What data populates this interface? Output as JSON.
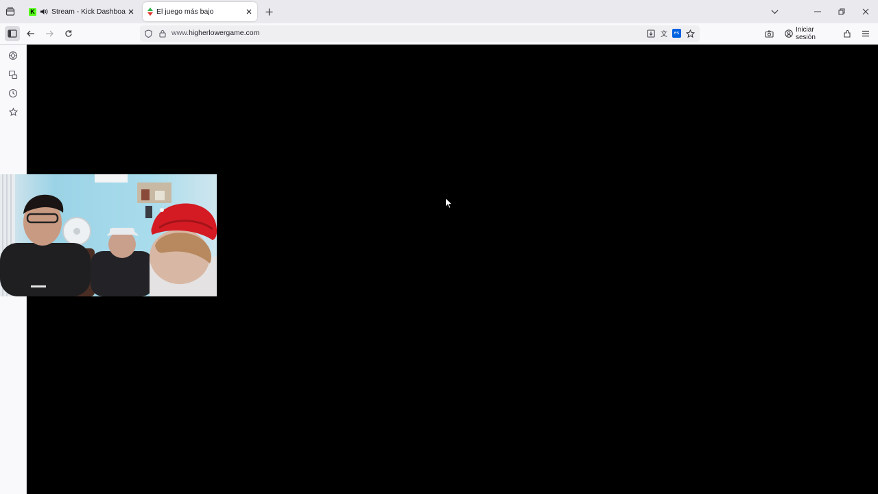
{
  "tabs": [
    {
      "title": "Stream - Kick Dashboard",
      "favicon": "kick-logo",
      "favicon_letter": "K",
      "audio": "speaker-icon"
    },
    {
      "title": "El juego más bajo",
      "favicon": "higher-lower-arrows",
      "active": true
    }
  ],
  "address_bar": {
    "url_prefix": "www.",
    "url_host": "higherlowergame.com",
    "translate_badge": "es"
  },
  "toolbar": {
    "signin_label": "Iniciar sesión"
  },
  "colors": {
    "kick_green": "#53fc18",
    "accent_blue": "#0061e0",
    "page_background": "#000000"
  }
}
